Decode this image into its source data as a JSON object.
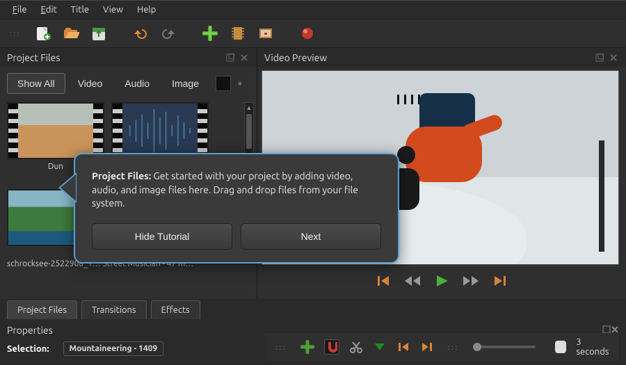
{
  "menubar": {
    "file": "File",
    "edit": "Edit",
    "title": "Title",
    "view": "View",
    "help": "Help"
  },
  "panel_titles": {
    "project_files": "Project Files",
    "video_preview": "Video Preview",
    "properties": "Properties"
  },
  "filters": {
    "show_all": "Show All",
    "video": "Video",
    "audio": "Audio",
    "image": "Image"
  },
  "thumbnails": {
    "dunes_label": "Dun",
    "truncated_row": "schrocksee-2522908_1…   Street Musician - 47 m…"
  },
  "tabs": {
    "project_files": "Project Files",
    "transitions": "Transitions",
    "effects": "Effects"
  },
  "properties": {
    "selection_label": "Selection:",
    "selection_value": "Mountaineering - 1409"
  },
  "timeline": {
    "duration": "3 seconds"
  },
  "tutorial": {
    "title": "Project Files:",
    "body": "Get started with your project by adding video, audio, and image files here. Drag and drop files from your file system.",
    "hide": "Hide Tutorial",
    "next": "Next"
  }
}
